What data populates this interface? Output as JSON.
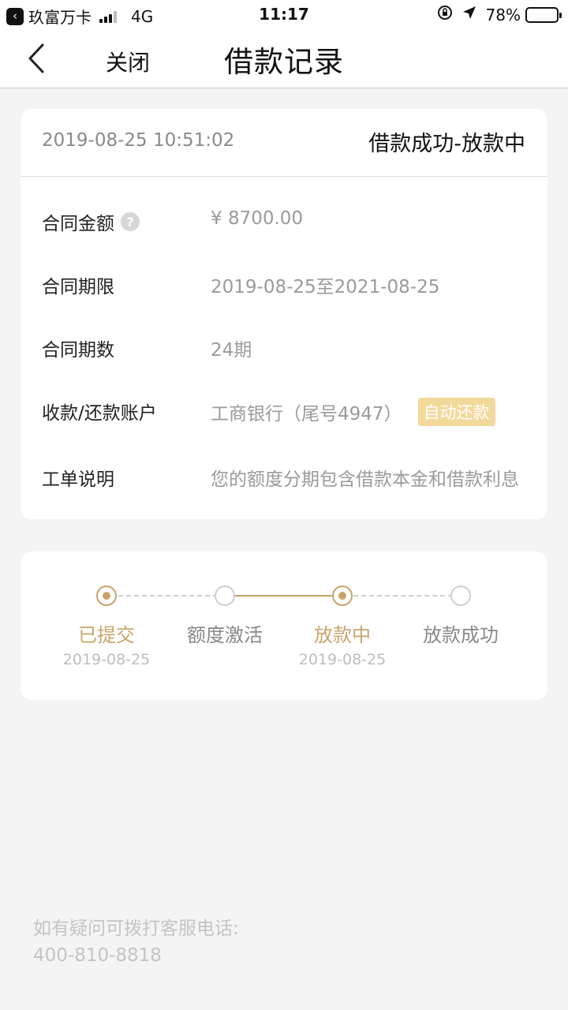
{
  "status_bar": {
    "back_app_label": "玖富万卡",
    "network": "4G",
    "time": "11:17",
    "battery_percent": "78%",
    "battery_level": 0.78
  },
  "nav": {
    "close_label": "关闭",
    "title": "借款记录"
  },
  "record": {
    "datetime": "2019-08-25 10:51:02",
    "status": "借款成功-放款中",
    "rows": [
      {
        "label": "合同金额",
        "value": "¥ 8700.00"
      },
      {
        "label": "合同期限",
        "value": "2019-08-25至2021-08-25"
      },
      {
        "label": "合同期数",
        "value": "24期"
      },
      {
        "label": "收款/还款账户",
        "value": "工商银行（尾号4947）",
        "badge": "自动还款"
      },
      {
        "label": "工单说明",
        "value": "您的额度分期包含借款本金和借款利息"
      }
    ]
  },
  "progress": {
    "steps": [
      {
        "label": "已提交",
        "date": "2019-08-25",
        "active": true
      },
      {
        "label": "额度激活",
        "date": "",
        "active": false
      },
      {
        "label": "放款中",
        "date": "2019-08-25",
        "active": true
      },
      {
        "label": "放款成功",
        "date": "",
        "active": false
      }
    ]
  },
  "footer": {
    "hint": "如有疑问可拨打客服电话:",
    "phone": "400-810-8818"
  },
  "colors": {
    "accent": "#c9a46a",
    "badge": "#f2d99b"
  }
}
